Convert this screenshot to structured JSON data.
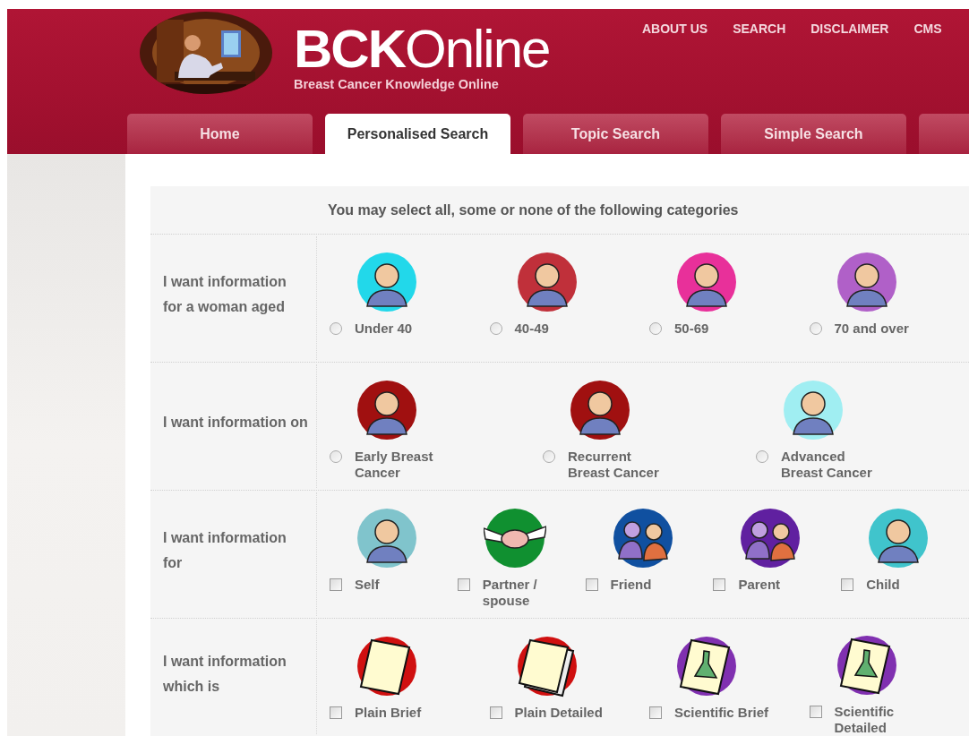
{
  "logo": {
    "title": "**BCK**Online",
    "subtitle": "Breast Cancer Knowledge Online"
  },
  "top_links": [
    "ABOUT US",
    "SEARCH",
    "DISCLAIMER",
    "CMS"
  ],
  "tabs": [
    {
      "label": "Home",
      "selected": false
    },
    {
      "label": "Personalised Search",
      "selected": true
    },
    {
      "label": "Topic Search",
      "selected": false
    },
    {
      "label": "Simple Search",
      "selected": false
    }
  ],
  "intro": "You may select all, some or none of the following categories",
  "sections": [
    {
      "label": "I want information for a woman aged",
      "kind": "radio",
      "options": [
        {
          "label": "Under 40",
          "selected": false,
          "kind": "person",
          "color": "#22d8ea"
        },
        {
          "label": "40-49",
          "selected": false,
          "kind": "person",
          "color": "#c0303a"
        },
        {
          "label": "50-69",
          "selected": false,
          "kind": "person",
          "color": "#e8309a"
        },
        {
          "label": "70 and over",
          "selected": false,
          "kind": "person",
          "color": "#b060c8"
        }
      ]
    },
    {
      "label": "I want information on",
      "kind": "radio",
      "options": [
        {
          "label": "Early Breast Cancer",
          "selected": false,
          "kind": "person",
          "color": "#a01010"
        },
        {
          "label": "Recurrent Breast Cancer",
          "selected": false,
          "kind": "person",
          "color": "#a01010"
        },
        {
          "label": "Advanced Breast Cancer",
          "selected": false,
          "kind": "person",
          "color": "#a0eef2"
        }
      ]
    },
    {
      "label": "I want information for",
      "kind": "checkbox",
      "options": [
        {
          "label": "Self",
          "checked": false,
          "kind": "person",
          "color": "#80c4cc"
        },
        {
          "label": "Partner / spouse",
          "checked": false,
          "kind": "handshake",
          "color": "#109030"
        },
        {
          "label": "Friend",
          "checked": false,
          "kind": "pair",
          "color": "#1050a0"
        },
        {
          "label": "Parent",
          "checked": false,
          "kind": "pair",
          "color": "#6020a0"
        },
        {
          "label": "Child",
          "checked": false,
          "kind": "person",
          "color": "#40c4cc"
        }
      ]
    },
    {
      "label": "I want information which is",
      "kind": "checkbox",
      "options": [
        {
          "label": "Plain Brief",
          "checked": false,
          "kind": "document",
          "color": "#d01010"
        },
        {
          "label": "Plain Detailed",
          "checked": false,
          "kind": "document_stack",
          "color": "#d01010"
        },
        {
          "label": "Scientific Brief",
          "checked": false,
          "kind": "flask_document",
          "color": "#8030b0"
        },
        {
          "label": "Scientific Detailed",
          "checked": false,
          "kind": "flask_document",
          "color": "#8030b0"
        }
      ]
    }
  ]
}
